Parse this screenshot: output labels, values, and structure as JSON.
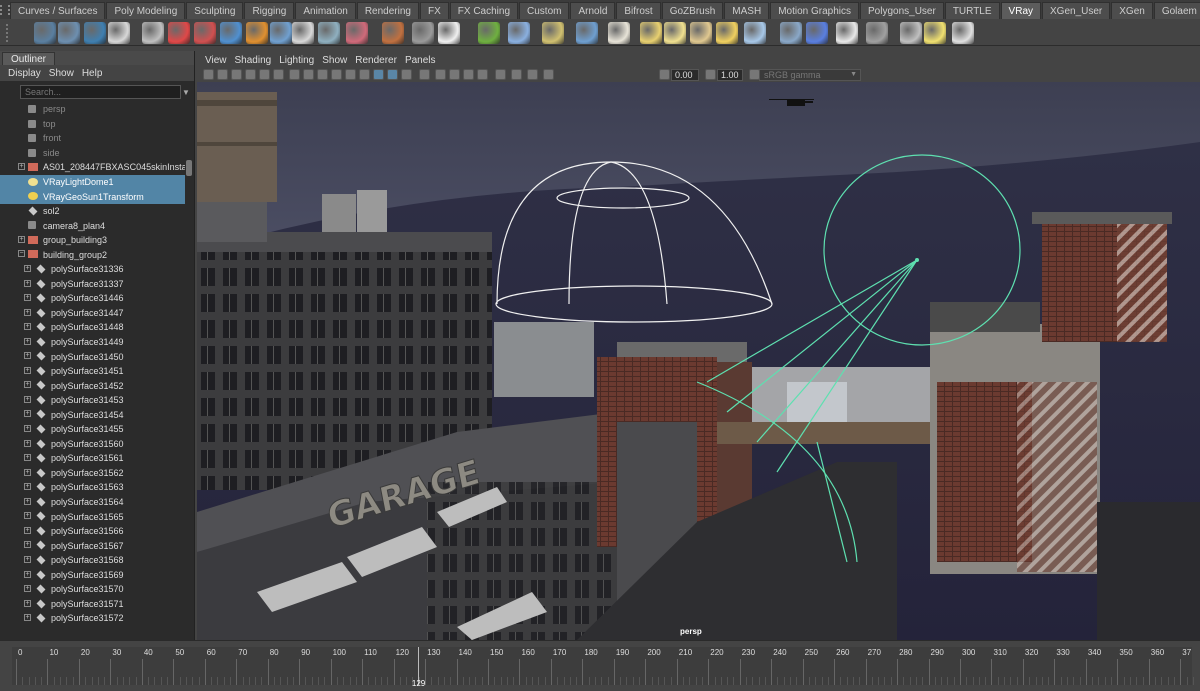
{
  "shelf": {
    "tabs": [
      "Curves / Surfaces",
      "Poly Modeling",
      "Sculpting",
      "Rigging",
      "Animation",
      "Rendering",
      "FX",
      "FX Caching",
      "Custom",
      "Arnold",
      "Bifrost",
      "GoZBrush",
      "MASH",
      "Motion Graphics",
      "Polygons_User",
      "TURTLE",
      "VRay",
      "XGen_User",
      "XGen",
      "Golaem"
    ],
    "active_tab": "VRay",
    "icons": [
      "vray-tools-icon",
      "vray-multi-icon",
      "vray-proxy-icon",
      "vray-logo-icon",
      "vray-render-icon",
      "vray-ipr-icon",
      "vray-vfb-icon",
      "vray-material-icon",
      "vray-fire-icon",
      "vray-displacement-icon",
      "vray-sphere-light-icon",
      "vray-fur-icon",
      "vray-water-icon",
      "vray-scatter-icon",
      "vray-clipper-icon",
      "vray-dome-light-icon",
      "vray-grass-icon",
      "vray-sparkle-icon",
      "vray-curve-icon",
      "vray-sphere-icon",
      "vray-rect-light-icon",
      "vray-spot-light-icon",
      "vray-omni-light-icon",
      "vray-ies-light-icon",
      "vray-sun-icon",
      "vray-plane-icon",
      "vray-mesh-light-icon",
      "vray-toggle-icon",
      "vray-checker-icon",
      "vray-physical-camera-icon",
      "vray-settings-icon",
      "vray-help-light-icon",
      "vray-help-icon"
    ]
  },
  "outliner": {
    "title": "Outliner",
    "menu": [
      "Display",
      "Show",
      "Help"
    ],
    "search_placeholder": "Search...",
    "items": [
      {
        "label": "persp",
        "type": "camera",
        "dim": true,
        "indent": 0,
        "expander": false
      },
      {
        "label": "top",
        "type": "camera",
        "dim": true,
        "indent": 0,
        "expander": false
      },
      {
        "label": "front",
        "type": "camera",
        "dim": true,
        "indent": 0,
        "expander": false
      },
      {
        "label": "side",
        "type": "camera",
        "dim": true,
        "indent": 0,
        "expander": false
      },
      {
        "label": "AS01_208447FBXASC045skinInstance",
        "type": "group",
        "dim": false,
        "indent": 0,
        "expander": true
      },
      {
        "label": "VRayLightDome1",
        "type": "dome",
        "dim": false,
        "indent": 0,
        "expander": false,
        "selected": true
      },
      {
        "label": "VRayGeoSun1Transform",
        "type": "sun",
        "dim": false,
        "indent": 0,
        "expander": false,
        "selected": true
      },
      {
        "label": "sol2",
        "type": "mesh",
        "dim": false,
        "indent": 0,
        "expander": false
      },
      {
        "label": "camera8_plan4",
        "type": "camera",
        "dim": false,
        "indent": 0,
        "expander": false
      },
      {
        "label": "group_building3",
        "type": "group",
        "dim": false,
        "indent": 0,
        "expander": true
      },
      {
        "label": "building_group2",
        "type": "group",
        "dim": false,
        "indent": 0,
        "expander": true,
        "expanded": true
      },
      {
        "label": "polySurface31336",
        "type": "mesh",
        "dim": false,
        "indent": 1,
        "expander": true
      },
      {
        "label": "polySurface31337",
        "type": "mesh",
        "dim": false,
        "indent": 1,
        "expander": true
      },
      {
        "label": "polySurface31446",
        "type": "mesh",
        "dim": false,
        "indent": 1,
        "expander": true
      },
      {
        "label": "polySurface31447",
        "type": "mesh",
        "dim": false,
        "indent": 1,
        "expander": true
      },
      {
        "label": "polySurface31448",
        "type": "mesh",
        "dim": false,
        "indent": 1,
        "expander": true
      },
      {
        "label": "polySurface31449",
        "type": "mesh",
        "dim": false,
        "indent": 1,
        "expander": true
      },
      {
        "label": "polySurface31450",
        "type": "mesh",
        "dim": false,
        "indent": 1,
        "expander": true
      },
      {
        "label": "polySurface31451",
        "type": "mesh",
        "dim": false,
        "indent": 1,
        "expander": true
      },
      {
        "label": "polySurface31452",
        "type": "mesh",
        "dim": false,
        "indent": 1,
        "expander": true
      },
      {
        "label": "polySurface31453",
        "type": "mesh",
        "dim": false,
        "indent": 1,
        "expander": true
      },
      {
        "label": "polySurface31454",
        "type": "mesh",
        "dim": false,
        "indent": 1,
        "expander": true
      },
      {
        "label": "polySurface31455",
        "type": "mesh",
        "dim": false,
        "indent": 1,
        "expander": true
      },
      {
        "label": "polySurface31560",
        "type": "mesh",
        "dim": false,
        "indent": 1,
        "expander": true
      },
      {
        "label": "polySurface31561",
        "type": "mesh",
        "dim": false,
        "indent": 1,
        "expander": true
      },
      {
        "label": "polySurface31562",
        "type": "mesh",
        "dim": false,
        "indent": 1,
        "expander": true
      },
      {
        "label": "polySurface31563",
        "type": "mesh",
        "dim": false,
        "indent": 1,
        "expander": true
      },
      {
        "label": "polySurface31564",
        "type": "mesh",
        "dim": false,
        "indent": 1,
        "expander": true
      },
      {
        "label": "polySurface31565",
        "type": "mesh",
        "dim": false,
        "indent": 1,
        "expander": true
      },
      {
        "label": "polySurface31566",
        "type": "mesh",
        "dim": false,
        "indent": 1,
        "expander": true
      },
      {
        "label": "polySurface31567",
        "type": "mesh",
        "dim": false,
        "indent": 1,
        "expander": true
      },
      {
        "label": "polySurface31568",
        "type": "mesh",
        "dim": false,
        "indent": 1,
        "expander": true
      },
      {
        "label": "polySurface31569",
        "type": "mesh",
        "dim": false,
        "indent": 1,
        "expander": true
      },
      {
        "label": "polySurface31570",
        "type": "mesh",
        "dim": false,
        "indent": 1,
        "expander": true
      },
      {
        "label": "polySurface31571",
        "type": "mesh",
        "dim": false,
        "indent": 1,
        "expander": true
      },
      {
        "label": "polySurface31572",
        "type": "mesh",
        "dim": false,
        "indent": 1,
        "expander": true
      }
    ]
  },
  "viewport": {
    "menu": [
      "View",
      "Shading",
      "Lighting",
      "Show",
      "Renderer",
      "Panels"
    ],
    "exposure": "0.00",
    "gamma": "1.00",
    "color_space": "sRGB gamma",
    "camera": "persp",
    "sign_text": "GARAGE",
    "colors": {
      "light_gizmo": "#5ee0b0",
      "dome_gizmo": "#f0f0f0",
      "sky": "#4a4d63"
    }
  },
  "timeline": {
    "start": 0,
    "end": 375,
    "major_step": 10,
    "labels": [
      "0",
      "10",
      "20",
      "30",
      "40",
      "50",
      "60",
      "70",
      "80",
      "90",
      "100",
      "110",
      "120",
      "130",
      "140",
      "150",
      "160",
      "170",
      "180",
      "190",
      "200",
      "210",
      "220",
      "230",
      "240",
      "250",
      "260",
      "270",
      "280",
      "290",
      "300",
      "310",
      "320",
      "330",
      "340",
      "350",
      "360",
      "37"
    ],
    "current_frame": "129"
  }
}
